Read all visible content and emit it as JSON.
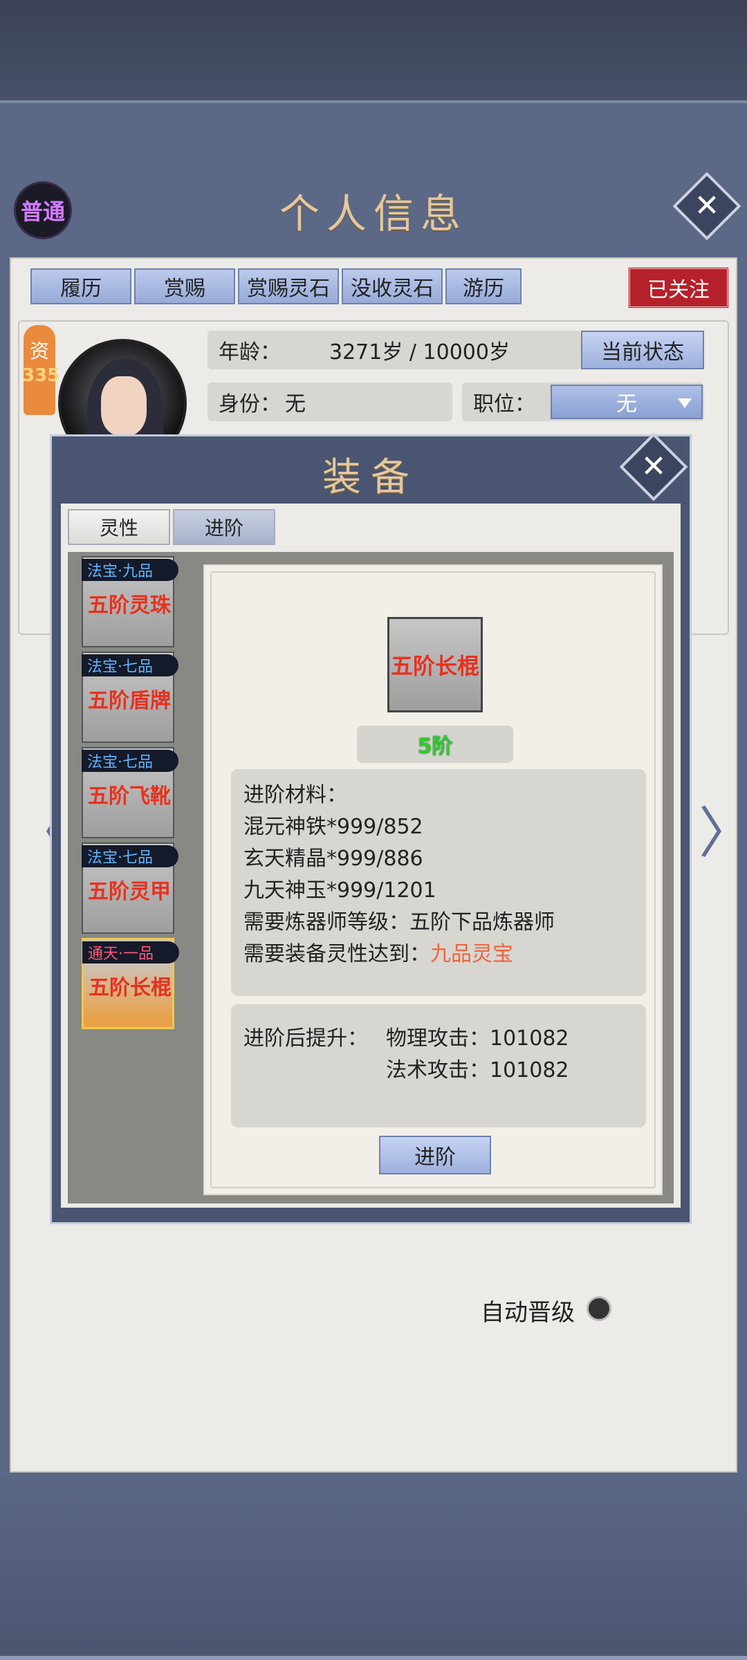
{
  "header": {
    "rank_badge": "普通",
    "title": "个人信息",
    "tabs": [
      "履历",
      "赏赐",
      "赏赐灵石",
      "没收灵石",
      "游历"
    ],
    "follow_label": "已关注"
  },
  "profile": {
    "quality_label": "资",
    "quality_value": "335",
    "age_label": "年龄：",
    "age_value": "3271岁 / 10000岁",
    "status_button": "当前状态",
    "identity_label": "身份：",
    "identity_value": "无",
    "position_label": "职位：",
    "position_value": "无",
    "auto_promote_label": "自动晋级"
  },
  "equipment_modal": {
    "title": "装备",
    "tabs": [
      "灵性",
      "进阶"
    ],
    "active_tab": "进阶",
    "items": [
      {
        "tag": "法宝·九品",
        "name": "五阶灵珠",
        "tag_color": "#5fb4ff",
        "selected": false
      },
      {
        "tag": "法宝·七品",
        "name": "五阶盾牌",
        "tag_color": "#5fb4ff",
        "selected": false
      },
      {
        "tag": "法宝·七品",
        "name": "五阶飞靴",
        "tag_color": "#5fb4ff",
        "selected": false
      },
      {
        "tag": "法宝·七品",
        "name": "五阶灵甲",
        "tag_color": "#5fb4ff",
        "selected": false
      },
      {
        "tag": "通天·一品",
        "name": "五阶长棍",
        "tag_color": "#ff5a78",
        "selected": true
      }
    ],
    "detail": {
      "item_name": "五阶长棍",
      "stage": "5阶",
      "materials_title": "进阶材料：",
      "materials": [
        "混元神铁*999/852",
        "玄天精晶*999/886",
        "九天神玉*999/1201"
      ],
      "refiner_requirement": "需要炼器师等级：五阶下品炼器师",
      "spirit_requirement_label": "需要装备灵性达到：",
      "spirit_requirement_value": "九品灵宝",
      "gain_label": "进阶后提升：",
      "gains": [
        "物理攻击：101082",
        "法术攻击：101082"
      ],
      "advance_button": "进阶"
    }
  }
}
